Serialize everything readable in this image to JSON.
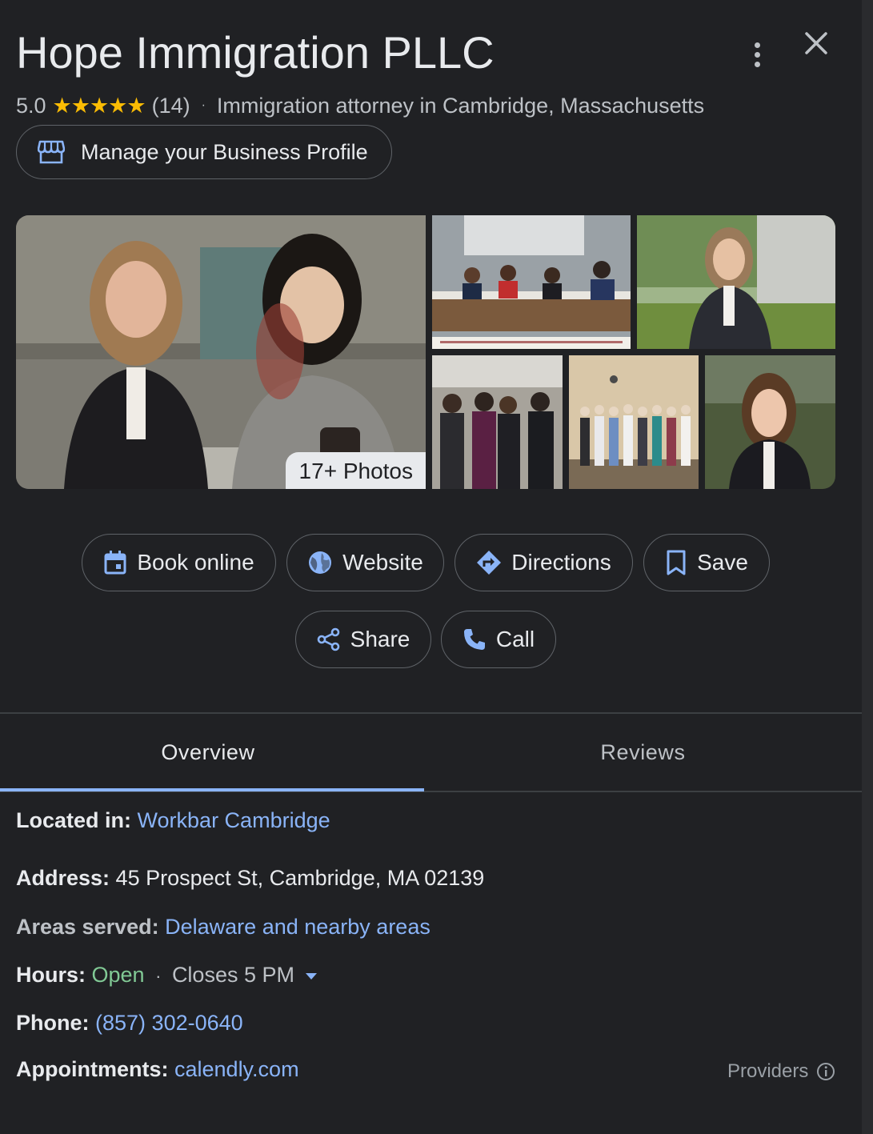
{
  "header": {
    "title": "Hope Immigration PLLC",
    "rating_value": "5.0",
    "stars_glyph": "★★★★★",
    "review_count": "(14)",
    "separator": "·",
    "category": "Immigration attorney in Cambridge, Massachusetts",
    "manage_label": "Manage your Business Profile"
  },
  "photos": {
    "count_label": "17+ Photos"
  },
  "actions": {
    "book": "Book online",
    "website": "Website",
    "directions": "Directions",
    "save": "Save",
    "share": "Share",
    "call": "Call"
  },
  "tabs": {
    "overview": "Overview",
    "reviews": "Reviews",
    "active": "Overview"
  },
  "info": {
    "located_label": "Located in:",
    "located_value": "Workbar Cambridge",
    "address_label": "Address:",
    "address_value": "45 Prospect St, Cambridge, MA 02139",
    "areas_label": "Areas served:",
    "areas_value": "Delaware and nearby areas",
    "hours_label": "Hours:",
    "hours_status": "Open",
    "hours_sep": "·",
    "hours_close": "Closes 5 PM",
    "phone_label": "Phone:",
    "phone_value": "(857) 302-0640",
    "appointments_label": "Appointments:",
    "appointments_value": "calendly.com",
    "providers_label": "Providers"
  },
  "colors": {
    "background": "#202124",
    "text": "#e8eaed",
    "link": "#8ab4f8",
    "open": "#81c995",
    "star": "#fbbc04",
    "border": "#5f6368"
  }
}
